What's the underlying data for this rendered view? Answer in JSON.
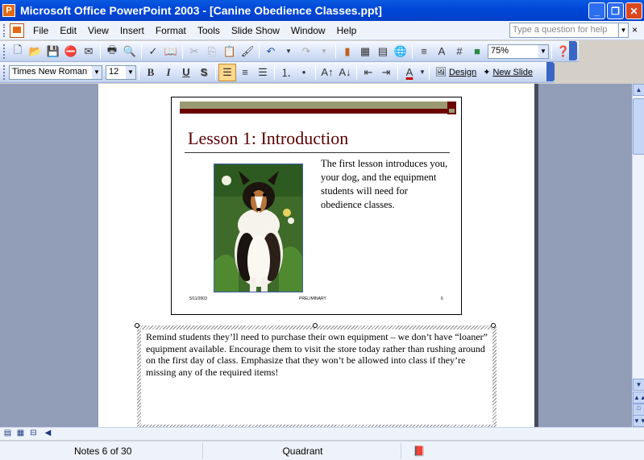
{
  "window": {
    "title": "Microsoft Office PowerPoint 2003 - [Canine Obedience Classes.ppt]",
    "app_icon": "powerpoint-icon"
  },
  "menubar": {
    "items": [
      "File",
      "Edit",
      "View",
      "Insert",
      "Format",
      "Tools",
      "Slide Show",
      "Window",
      "Help"
    ],
    "ask_placeholder": "Type a question for help",
    "close_glyph": "×"
  },
  "toolbar_standard": {
    "zoom": "75%"
  },
  "toolbar_formatting": {
    "font": "Times New Roman",
    "size": "12",
    "bold": "B",
    "italic": "I",
    "underline": "U",
    "shadow": "S",
    "design_label": "Design",
    "new_slide_label": "New Slide"
  },
  "slide": {
    "title": "Lesson 1: Introduction",
    "body": "The first lesson introduces you, your dog, and the equipment students will need for obedience classes.",
    "footer_date": "5/11/2003",
    "footer_center": "PRELIMINARY",
    "footer_number": "6",
    "photo": "collie-dog-photo",
    "colors": {
      "title": "#5a0000",
      "bar_top": "#9a9a72",
      "bar_bottom": "#6b0000"
    }
  },
  "notes": {
    "text": "Remind students they’ll need to purchase their own equipment – we don’t have “loaner” equipment available. Encourage them to visit the store today rather than rushing around on the first day of class. Emphasize that they won’t be allowed into class if they’re missing any of the required items!"
  },
  "statusbar": {
    "notes_position": "Notes 6 of 30",
    "design": "Quadrant"
  }
}
